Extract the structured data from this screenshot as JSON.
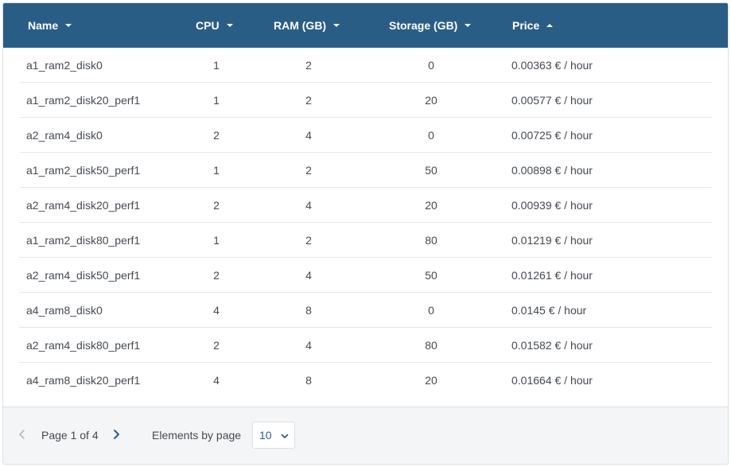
{
  "table": {
    "columns": [
      {
        "label": "Name",
        "sort": "down"
      },
      {
        "label": "CPU",
        "sort": "down"
      },
      {
        "label": "RAM (GB)",
        "sort": "down"
      },
      {
        "label": "Storage (GB)",
        "sort": "down"
      },
      {
        "label": "Price",
        "sort": "up"
      }
    ],
    "rows": [
      {
        "name": "a1_ram2_disk0",
        "cpu": "1",
        "ram": "2",
        "storage": "0",
        "price": "0.00363 € / hour"
      },
      {
        "name": "a1_ram2_disk20_perf1",
        "cpu": "1",
        "ram": "2",
        "storage": "20",
        "price": "0.00577 € / hour"
      },
      {
        "name": "a2_ram4_disk0",
        "cpu": "2",
        "ram": "4",
        "storage": "0",
        "price": "0.00725 € / hour"
      },
      {
        "name": "a1_ram2_disk50_perf1",
        "cpu": "1",
        "ram": "2",
        "storage": "50",
        "price": "0.00898 € / hour"
      },
      {
        "name": "a2_ram4_disk20_perf1",
        "cpu": "2",
        "ram": "4",
        "storage": "20",
        "price": "0.00939 € / hour"
      },
      {
        "name": "a1_ram2_disk80_perf1",
        "cpu": "1",
        "ram": "2",
        "storage": "80",
        "price": "0.01219 € / hour"
      },
      {
        "name": "a2_ram4_disk50_perf1",
        "cpu": "2",
        "ram": "4",
        "storage": "50",
        "price": "0.01261 € / hour"
      },
      {
        "name": "a4_ram8_disk0",
        "cpu": "4",
        "ram": "8",
        "storage": "0",
        "price": "0.0145 € / hour"
      },
      {
        "name": "a2_ram4_disk80_perf1",
        "cpu": "2",
        "ram": "4",
        "storage": "80",
        "price": "0.01582 € / hour"
      },
      {
        "name": "a4_ram8_disk20_perf1",
        "cpu": "4",
        "ram": "8",
        "storage": "20",
        "price": "0.01664 € / hour"
      }
    ]
  },
  "pagination": {
    "page_text": "Page 1 of 4",
    "prev_icon": "chevron-left-icon",
    "next_icon": "chevron-right-icon",
    "elements_label": "Elements by page",
    "elements_value": "10"
  },
  "colors": {
    "header_bg": "#2a5d86",
    "accent": "#2a5d86",
    "footer_bg": "#f4f5f6",
    "text": "#444a52",
    "disabled": "#b5bac0"
  }
}
